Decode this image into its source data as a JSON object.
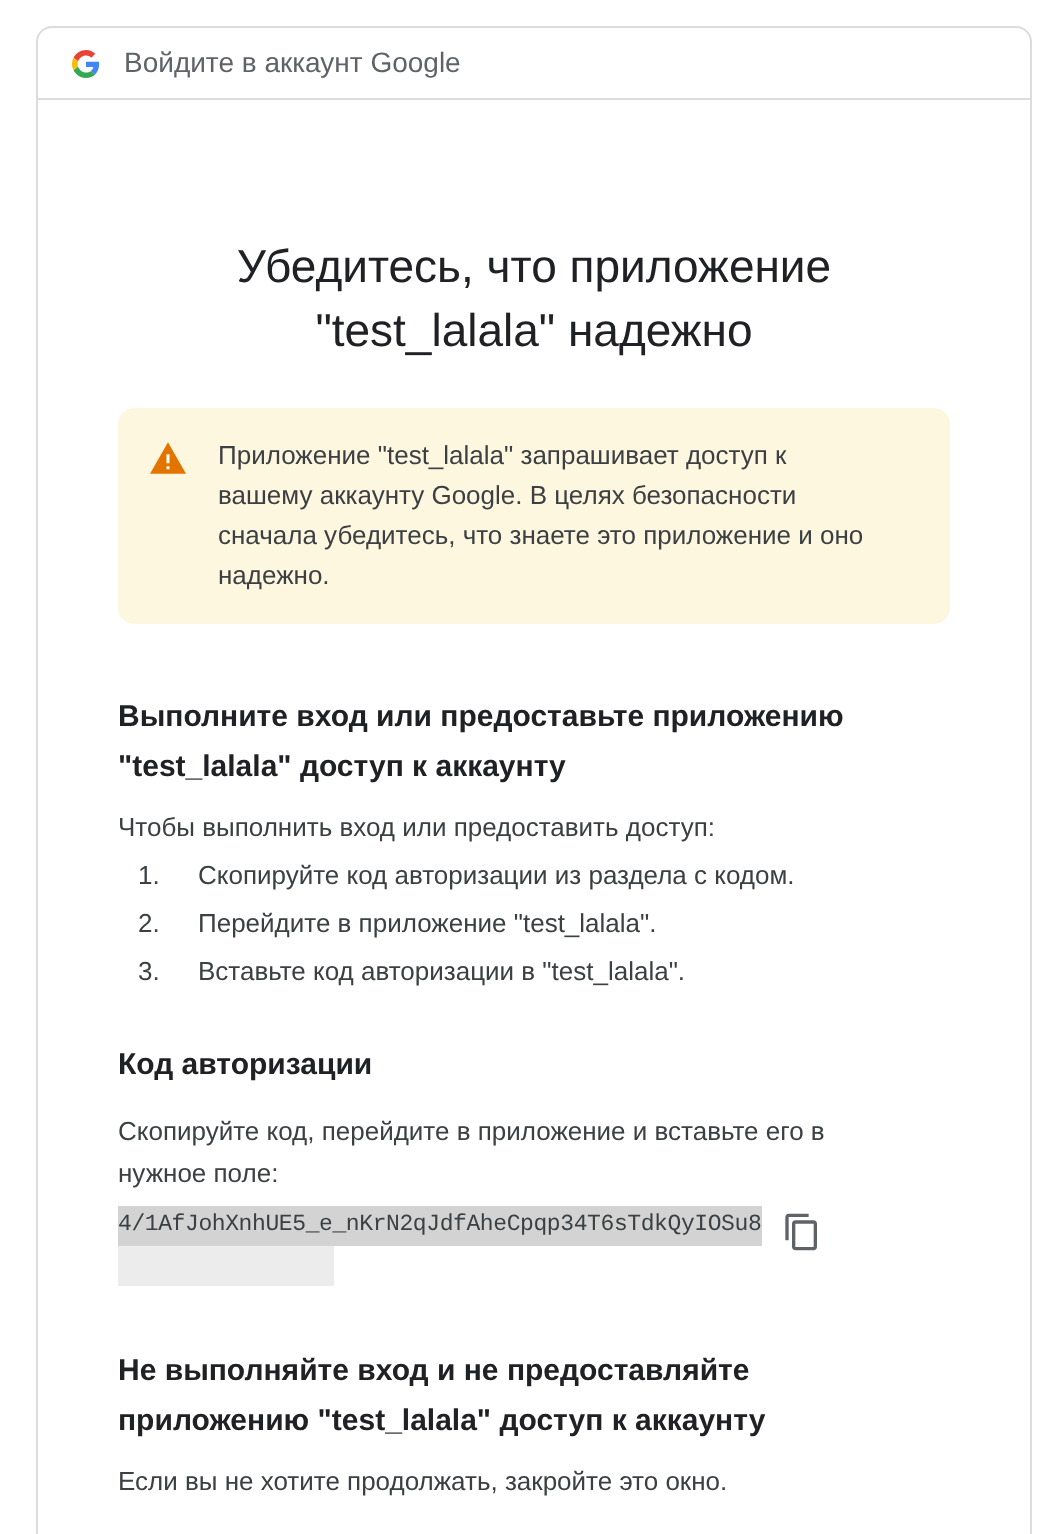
{
  "header": {
    "title": "Войдите в аккаунт Google"
  },
  "title": "Убедитесь, что приложение \"test_lalala\" надежно",
  "warning": {
    "text": "Приложение \"test_lalala\" запрашивает доступ к вашему аккаунту Google. В целях безопасности сначала убедитесь, что знаете это приложение и оно надежно."
  },
  "sign_in": {
    "heading": "Выполните вход или предоставьте приложению \"test_lalala\" доступ к аккаунту",
    "intro": "Чтобы выполнить вход или предоставить доступ:",
    "steps": [
      {
        "number": "1.",
        "text": "Скопируйте код авторизации из раздела с кодом."
      },
      {
        "number": "2.",
        "text": "Перейдите в приложение \"test_lalala\"."
      },
      {
        "number": "3.",
        "text": "Вставьте код авторизации в \"test_lalala\"."
      }
    ]
  },
  "code_section": {
    "heading": "Код авторизации",
    "hint": "Скопируйте код, перейдите в приложение и вставьте его в нужное поле:",
    "code": "4/1AfJohXnhUE5_e_nKrN2qJdfAheCpqp34T6sTdkQyIOSu8",
    "redacted": true
  },
  "deny": {
    "heading": "Не выполняйте вход и не предоставляйте приложению \"test_lalala\" доступ к аккаунту",
    "text": "Если вы не хотите продолжать, закройте это окно."
  }
}
